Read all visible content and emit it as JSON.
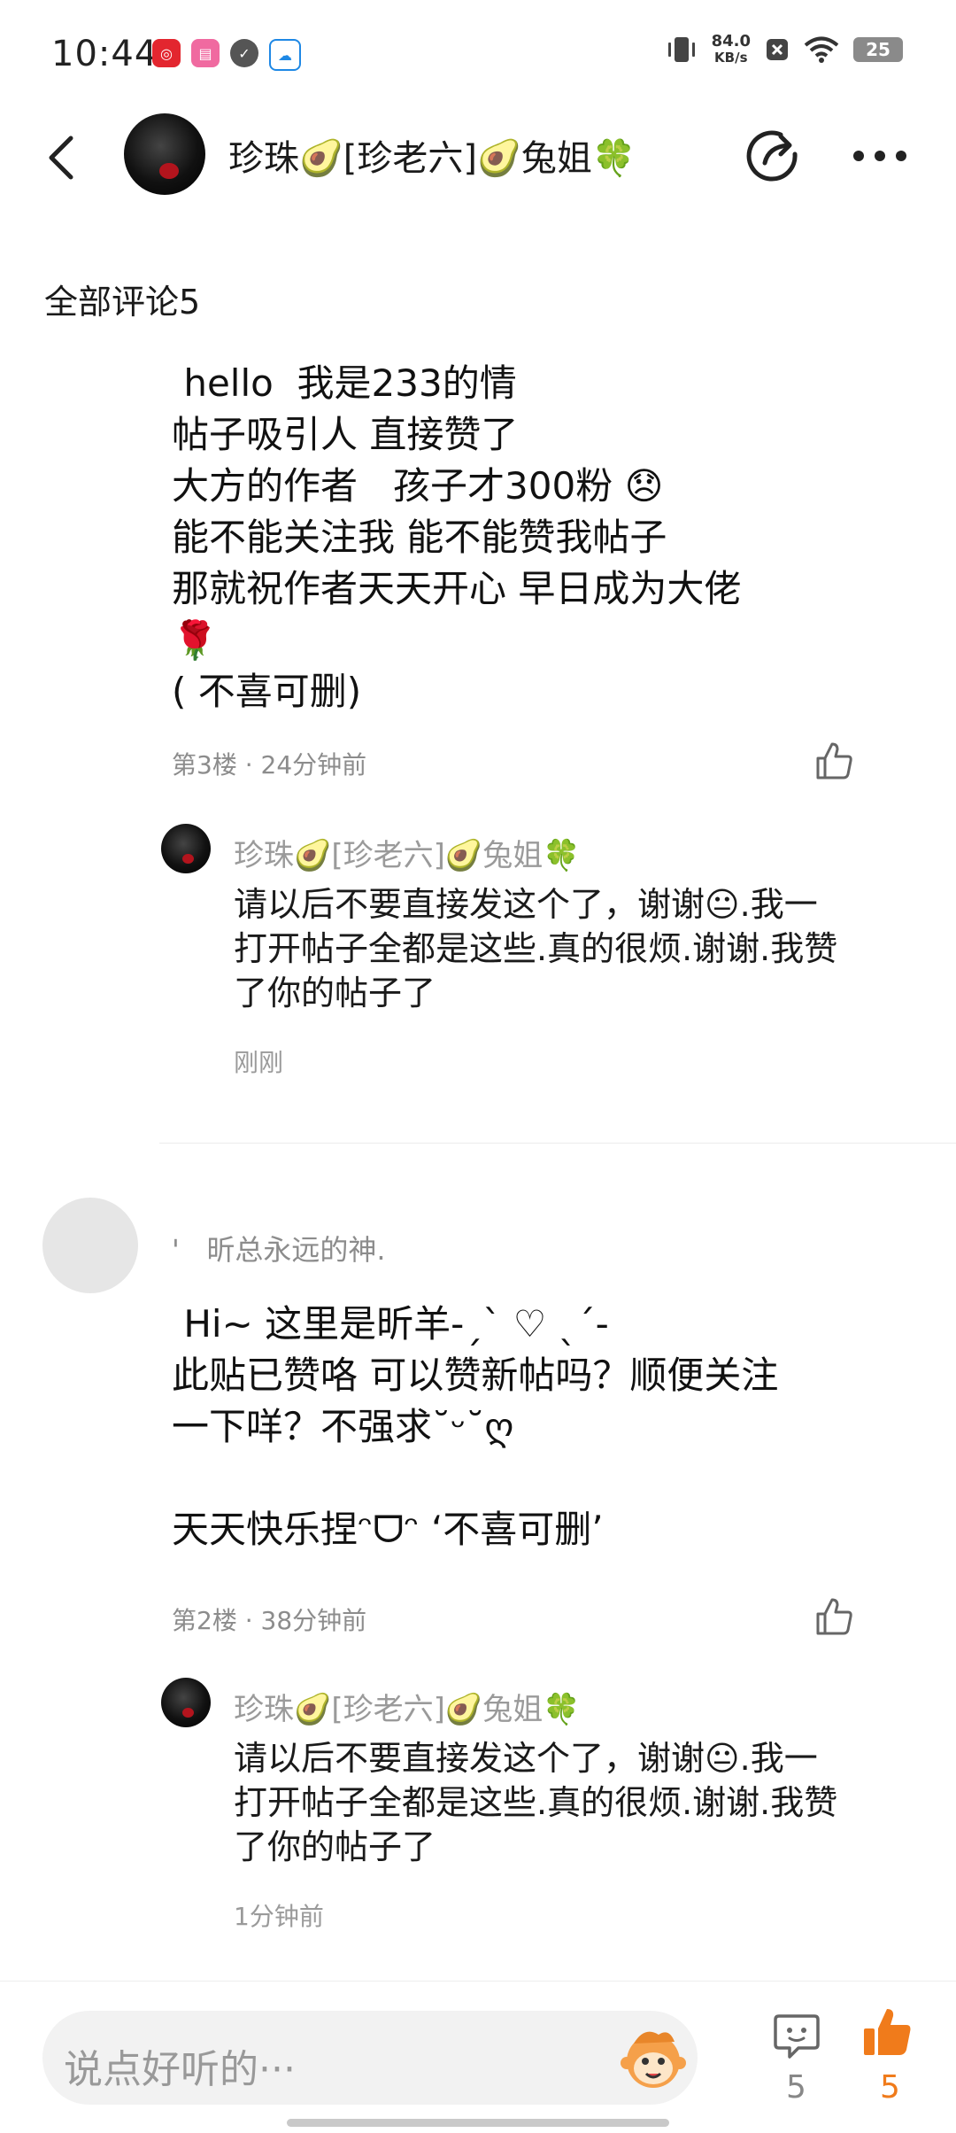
{
  "status_bar": {
    "time": "10:44",
    "speed_value": "84.0",
    "speed_unit": "KB/s",
    "battery": "25",
    "app_icons": [
      "netease-music-icon",
      "pink-app-icon",
      "check-circle-icon",
      "cloud-drive-icon"
    ]
  },
  "header": {
    "title": "珍珠🥑[珍老六]🥑兔姐🍀"
  },
  "section": {
    "all_comments": "全部评论5"
  },
  "comments": [
    {
      "text": " hello  我是233的情\n帖子吸引人 直接赞了\n大方的作者   孩子才300粉 😞\n能不能关注我 能不能赞我帖子\n那就祝作者天天开心 早日成为大佬\n🌹\n( 不喜可删)",
      "meta": "第3楼 · 24分钟前",
      "reply": {
        "name": "珍珠🥑[珍老六]🥑兔姐🍀",
        "text": "请以后不要直接发这个了，谢谢😐.我一\n打开帖子全都是这些.真的很烦.谢谢.我赞\n了你的帖子了",
        "time": "刚刚"
      }
    },
    {
      "user": "'   昕总永远的神.",
      "text": " Hi~ 这里是昕羊-ˏˋ ♡ ˎˊ-\n此贴已赞咯 可以赞新帖吗？顺便关注\n一下咩？不强求˘ᵕ˘ღ\n\n天天快乐捏ᵔᗜᵔ ‘不喜可删’",
      "meta": "第2楼 · 38分钟前",
      "reply": {
        "name": "珍珠🥑[珍老六]🥑兔姐🍀",
        "text": "请以后不要直接发这个了，谢谢😐.我一\n打开帖子全都是这些.真的很烦.谢谢.我赞\n了你的帖子了",
        "time": "1分钟前"
      }
    }
  ],
  "bottom_bar": {
    "placeholder": "说点好听的···",
    "comment_count": "5",
    "like_count": "5"
  },
  "colors": {
    "accent": "#f07b1b",
    "meta_gray": "#8c8c8c"
  }
}
